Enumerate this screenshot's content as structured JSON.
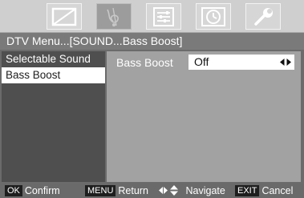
{
  "icons": [
    {
      "name": "picture-icon",
      "active": false
    },
    {
      "name": "sound-icon",
      "active": true
    },
    {
      "name": "setup-icon",
      "active": false
    },
    {
      "name": "clock-icon",
      "active": false
    },
    {
      "name": "tools-icon",
      "active": false
    }
  ],
  "title": "DTV Menu...[SOUND...Bass Boost]",
  "menu": {
    "items": [
      {
        "label": "Selectable Sound",
        "selected": false
      },
      {
        "label": "Bass Boost",
        "selected": true
      }
    ]
  },
  "setting": {
    "label": "Bass Boost",
    "value": "Off",
    "arrows_icon": "left-right-arrows-icon"
  },
  "help": {
    "confirm_key": "OK",
    "confirm": "Confirm",
    "return_key": "MENU",
    "return": "Return",
    "navigate": "Navigate",
    "exit_key": "EXIT",
    "cancel": "Cancel"
  },
  "colors": {
    "panel_bg": "#a2a2a2",
    "menu_bg": "#4f4f4f",
    "selected_bg": "#ffffff"
  }
}
